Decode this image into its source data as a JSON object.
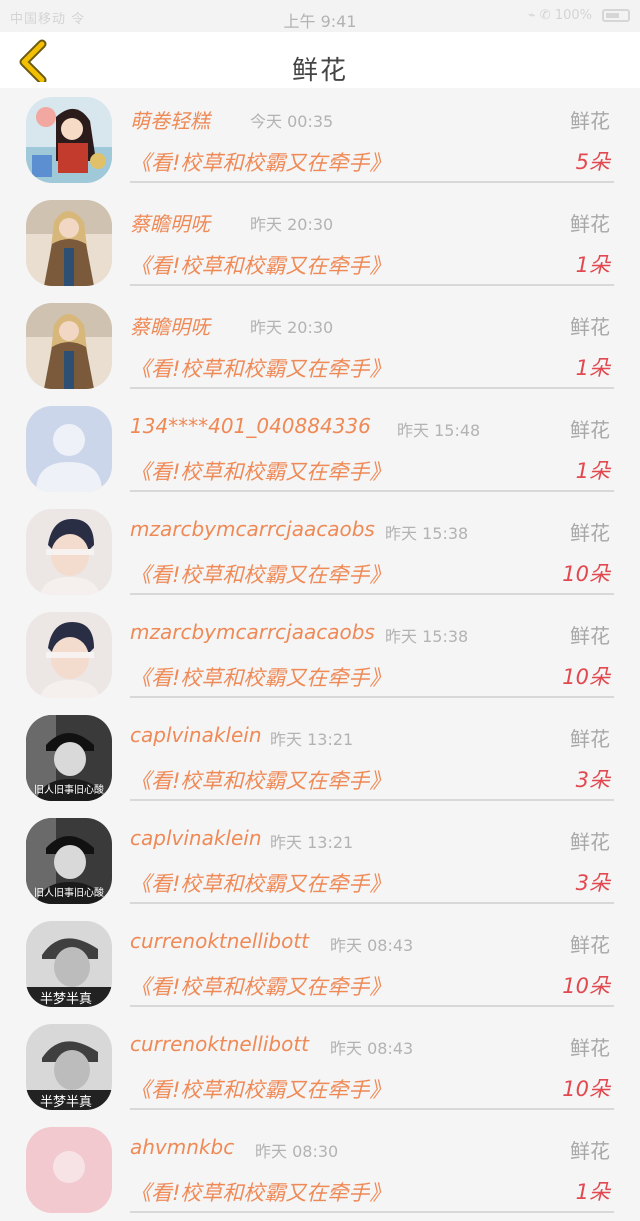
{
  "status_bar": {
    "signal": "中国移动 令",
    "time": "上午 9:41",
    "icons": "⌁ ✆ 100%"
  },
  "header": {
    "title": "鲜花",
    "back_icon": "chevron-left-icon",
    "accent_color": "#f2c000"
  },
  "list": [
    {
      "name": "萌卷轻糕",
      "time": "今天 00:35",
      "type_label": "鲜花",
      "book": "《看!校草和校霸又在牵手》",
      "count": "5朵",
      "avatar": "anime"
    },
    {
      "name": "蔡瞻明呒",
      "time": "昨天 20:30",
      "type_label": "鲜花",
      "book": "《看!校草和校霸又在牵手》",
      "count": "1朵",
      "avatar": "girl"
    },
    {
      "name": "蔡瞻明呒",
      "time": "昨天 20:30",
      "type_label": "鲜花",
      "book": "《看!校草和校霸又在牵手》",
      "count": "1朵",
      "avatar": "girl"
    },
    {
      "name": "134****401_040884336",
      "time": "昨天 15:48",
      "type_label": "鲜花",
      "book": "《看!校草和校霸又在牵手》",
      "count": "1朵",
      "avatar": "default"
    },
    {
      "name": "mzarcbymcarrcjaacaobs",
      "time": "昨天 15:38",
      "type_label": "鲜花",
      "book": "《看!校草和校霸又在牵手》",
      "count": "10朵",
      "avatar": "boy"
    },
    {
      "name": "mzarcbymcarrcjaacaobs",
      "time": "昨天 15:38",
      "type_label": "鲜花",
      "book": "《看!校草和校霸又在牵手》",
      "count": "10朵",
      "avatar": "boy"
    },
    {
      "name": "caplvinaklein",
      "time": "昨天 13:21",
      "type_label": "鲜花",
      "book": "《看!校草和校霸又在牵手》",
      "count": "3朵",
      "avatar": "bw"
    },
    {
      "name": "caplvinaklein",
      "time": "昨天 13:21",
      "type_label": "鲜花",
      "book": "《看!校草和校霸又在牵手》",
      "count": "3朵",
      "avatar": "bw"
    },
    {
      "name": "currenoktnellibott",
      "time": "昨天 08:43",
      "type_label": "鲜花",
      "book": "《看!校草和校霸又在牵手》",
      "count": "10朵",
      "avatar": "gray"
    },
    {
      "name": "currenoktnellibott",
      "time": "昨天 08:43",
      "type_label": "鲜花",
      "book": "《看!校草和校霸又在牵手》",
      "count": "10朵",
      "avatar": "gray"
    },
    {
      "name": "ahvmnkbc",
      "time": "昨天 08:30",
      "type_label": "鲜花",
      "book": "《看!校草和校霸又在牵手》",
      "count": "1朵",
      "avatar": "pink"
    }
  ],
  "avatar_captions": {
    "bw": "旧人旧事旧心酸",
    "gray": "半梦半真"
  }
}
